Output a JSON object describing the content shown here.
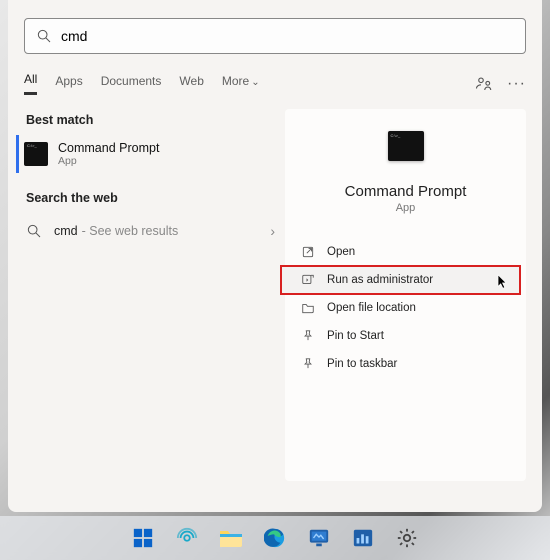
{
  "search": {
    "value": "cmd"
  },
  "tabs": {
    "all": "All",
    "apps": "Apps",
    "documents": "Documents",
    "web": "Web",
    "more": "More"
  },
  "sections": {
    "best_match": "Best match",
    "search_web": "Search the web"
  },
  "best_match": {
    "title": "Command Prompt",
    "subtitle": "App"
  },
  "web_result": {
    "term": "cmd",
    "suffix": "- See web results"
  },
  "preview": {
    "title": "Command Prompt",
    "subtitle": "App"
  },
  "actions": {
    "open": "Open",
    "run_admin": "Run as administrator",
    "open_location": "Open file location",
    "pin_start": "Pin to Start",
    "pin_taskbar": "Pin to taskbar"
  }
}
